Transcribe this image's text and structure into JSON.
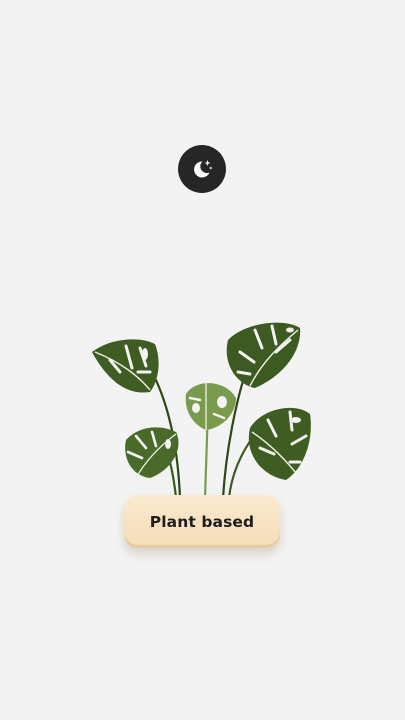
{
  "screen": {
    "background": "#f3f3f3"
  },
  "theme_toggle": {
    "icon": "moon-stars-icon",
    "background": "#262626",
    "icon_color": "#ffffff"
  },
  "plant": {
    "icon": "monstera-plant-illustration",
    "leaf_dark": "#3c5a22",
    "leaf_light": "#7a9a4e"
  },
  "pot": {
    "label": "Plant based",
    "color": "#f6e1c2"
  }
}
